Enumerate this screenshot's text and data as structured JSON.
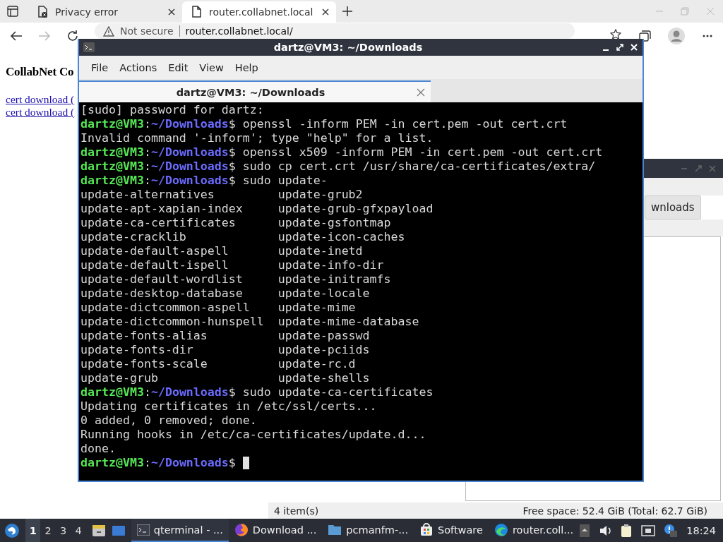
{
  "browser": {
    "tabs": [
      {
        "title": "Privacy error",
        "kind": "error",
        "selected": false
      },
      {
        "title": "router.collabnet.local",
        "kind": "page",
        "selected": true
      }
    ],
    "address": {
      "security": "Not secure",
      "url": "router.collabnet.local/"
    },
    "page": {
      "heading": "CollabNet Co",
      "links": [
        "cert download (",
        "cert download ("
      ]
    }
  },
  "file_manager": {
    "location_button": "wnloads",
    "status": {
      "items": "4 item(s)",
      "free_space": "Free space: 52.4 GiB (Total: 62.7 GiB)"
    }
  },
  "terminal": {
    "title": "dartz@VM3: ~/Downloads",
    "menu": [
      "File",
      "Actions",
      "Edit",
      "View",
      "Help"
    ],
    "tabs": [
      {
        "title": "dartz@VM3: ~/Downloads",
        "selected": true
      }
    ],
    "lines": [
      {
        "kind": "output",
        "text": "[sudo] password for dartz:"
      },
      {
        "kind": "prompt",
        "user": "dartz@VM3",
        "sep": ":",
        "path": "~/Downloads",
        "command": "$ openssl -inform PEM -in cert.pem -out cert.crt"
      },
      {
        "kind": "output",
        "text": "Invalid command '-inform'; type \"help\" for a list."
      },
      {
        "kind": "prompt",
        "user": "dartz@VM3",
        "sep": ":",
        "path": "~/Downloads",
        "command": "$ openssl x509 -inform PEM -in cert.pem -out cert.crt"
      },
      {
        "kind": "prompt",
        "user": "dartz@VM3",
        "sep": ":",
        "path": "~/Downloads",
        "command": "$ sudo cp cert.crt /usr/share/ca-certificates/extra/"
      },
      {
        "kind": "prompt",
        "user": "dartz@VM3",
        "sep": ":",
        "path": "~/Downloads",
        "command": "$ sudo update-"
      },
      {
        "kind": "columns",
        "cells": [
          "update-alternatives",
          "update-grub2"
        ]
      },
      {
        "kind": "columns",
        "cells": [
          "update-apt-xapian-index",
          "update-grub-gfxpayload"
        ]
      },
      {
        "kind": "columns",
        "cells": [
          "update-ca-certificates",
          "update-gsfontmap"
        ]
      },
      {
        "kind": "columns",
        "cells": [
          "update-cracklib",
          "update-icon-caches"
        ]
      },
      {
        "kind": "columns",
        "cells": [
          "update-default-aspell",
          "update-inetd"
        ]
      },
      {
        "kind": "columns",
        "cells": [
          "update-default-ispell",
          "update-info-dir"
        ]
      },
      {
        "kind": "columns",
        "cells": [
          "update-default-wordlist",
          "update-initramfs"
        ]
      },
      {
        "kind": "columns",
        "cells": [
          "update-desktop-database",
          "update-locale"
        ]
      },
      {
        "kind": "columns",
        "cells": [
          "update-dictcommon-aspell",
          "update-mime"
        ]
      },
      {
        "kind": "columns",
        "cells": [
          "update-dictcommon-hunspell",
          "update-mime-database"
        ]
      },
      {
        "kind": "columns",
        "cells": [
          "update-fonts-alias",
          "update-passwd"
        ]
      },
      {
        "kind": "columns",
        "cells": [
          "update-fonts-dir",
          "update-pciids"
        ]
      },
      {
        "kind": "columns",
        "cells": [
          "update-fonts-scale",
          "update-rc.d"
        ]
      },
      {
        "kind": "columns",
        "cells": [
          "update-grub",
          "update-shells"
        ]
      },
      {
        "kind": "prompt",
        "user": "dartz@VM3",
        "sep": ":",
        "path": "~/Downloads",
        "command": "$ sudo update-ca-certificates"
      },
      {
        "kind": "output",
        "text": "Updating certificates in /etc/ssl/certs..."
      },
      {
        "kind": "output",
        "text": "0 added, 0 removed; done."
      },
      {
        "kind": "output",
        "text": "Running hooks in /etc/ca-certificates/update.d..."
      },
      {
        "kind": "output",
        "text": "done."
      },
      {
        "kind": "prompt",
        "user": "dartz@VM3",
        "sep": ":",
        "path": "~/Downloads",
        "command": "$",
        "cursor": true
      }
    ]
  },
  "taskbar": {
    "workspaces": [
      {
        "label": "1",
        "selected": true
      },
      {
        "label": "2",
        "selected": false
      },
      {
        "label": "3",
        "selected": false
      },
      {
        "label": "4",
        "selected": false
      }
    ],
    "tasks": [
      {
        "label": "qterminal - ...",
        "kind": "terminal",
        "selected": true
      },
      {
        "label": "Download ...",
        "kind": "browser-fox",
        "selected": false
      },
      {
        "label": "pcmanfm-...",
        "kind": "folder",
        "selected": false
      },
      {
        "label": "Software",
        "kind": "store",
        "selected": false
      },
      {
        "label": "router.coll...",
        "kind": "browser-wave",
        "selected": false
      }
    ],
    "clock": "18:24"
  }
}
